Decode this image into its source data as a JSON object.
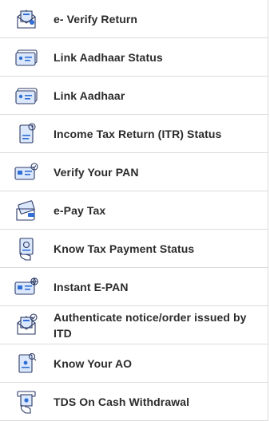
{
  "colors": {
    "text": "#2b2b2b",
    "icon_outline": "#2b3a67",
    "icon_blue": "#2f6fd6",
    "icon_fill": "#dbe7fb",
    "divider": "#dcdcdc"
  },
  "menu": {
    "items": [
      {
        "label": "e- Verify Return",
        "icon": "envelope-document-icon"
      },
      {
        "label": "Link Aadhaar Status",
        "icon": "id-card-icon"
      },
      {
        "label": "Link Aadhaar",
        "icon": "id-card-icon"
      },
      {
        "label": "Income Tax Return (ITR) Status",
        "icon": "document-clock-icon"
      },
      {
        "label": "Verify Your PAN",
        "icon": "card-check-icon"
      },
      {
        "label": "e-Pay Tax",
        "icon": "wallet-card-icon"
      },
      {
        "label": "Know Tax Payment Status",
        "icon": "hand-document-icon"
      },
      {
        "label": "Instant E-PAN",
        "icon": "card-globe-icon"
      },
      {
        "label": "Authenticate notice/order issued by ITD",
        "icon": "envelope-check-icon"
      },
      {
        "label": "Know Your AO",
        "icon": "document-search-icon"
      },
      {
        "label": "TDS On Cash Withdrawal",
        "icon": "atm-withdrawal-icon"
      }
    ]
  }
}
